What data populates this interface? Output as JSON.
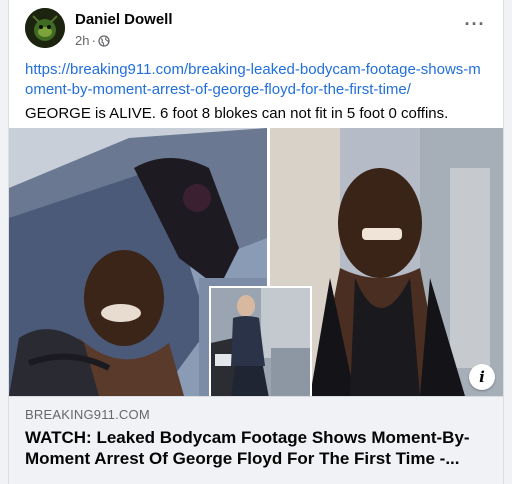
{
  "post": {
    "author": "Daniel Dowell",
    "time": "2h",
    "separator": "·",
    "more_label": "···",
    "link_url": "https://breaking911.com/breaking-leaked-bodycam-footage-shows-moment-by-moment-arrest-of-george-floyd-for-the-first-time/",
    "body": "GEORGE is ALIVE. 6 foot 8 blokes can not fit in 5 foot 0 coffins."
  },
  "images": {
    "info_label": "i"
  },
  "preview": {
    "domain": "BREAKING911.COM",
    "headline": "WATCH: Leaked Bodycam Footage Shows Moment-By-Moment Arrest Of George Floyd For The First Time -..."
  },
  "icons": {
    "audience": "globe-icon",
    "more": "more-options-icon",
    "info": "info-icon"
  },
  "colors": {
    "link": "#216fdb",
    "secondary_text": "#65676b",
    "background": "#f0f2f5"
  }
}
